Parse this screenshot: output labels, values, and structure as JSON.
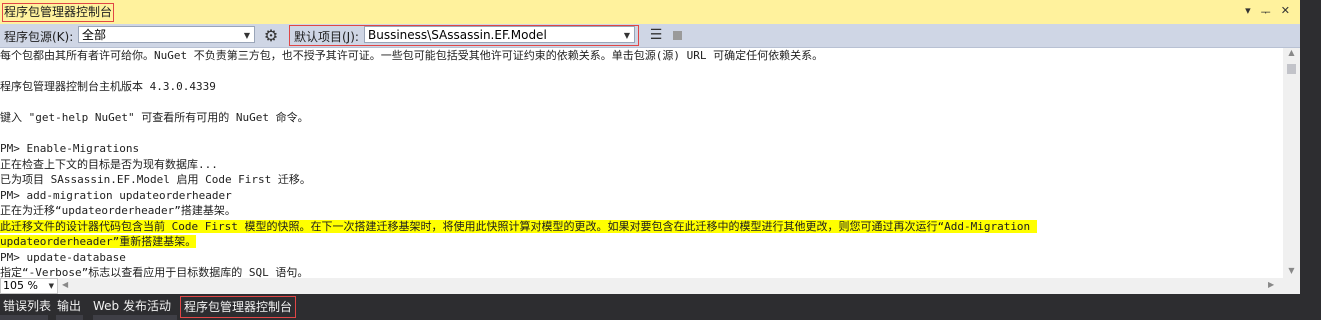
{
  "title": "程序包管理器控制台",
  "toolbar": {
    "source_label": "程序包源(K):",
    "source_value": "全部",
    "project_label": "默认项目(J):",
    "project_value": "Bussiness\\SAssassin.EF.Model"
  },
  "icons": {
    "settings": "gear-icon",
    "clear": "clear-console-icon",
    "stop": "stop-icon",
    "dropdown": "chevron-down-icon"
  },
  "console_lines": [
    {
      "text": "每个包都由其所有者许可给你。NuGet 不负责第三方包，也不授予其许可证。一些包可能包括受其他许可证约束的依赖关系。单击包源(源) URL 可确定任何依赖关系。",
      "highlight": false
    },
    {
      "text": "",
      "highlight": false
    },
    {
      "text": "程序包管理器控制台主机版本 4.3.0.4339",
      "highlight": false
    },
    {
      "text": "",
      "highlight": false
    },
    {
      "text": "键入 \"get-help NuGet\" 可查看所有可用的 NuGet 命令。",
      "highlight": false
    },
    {
      "text": "",
      "highlight": false
    },
    {
      "text": "PM> Enable-Migrations",
      "highlight": false
    },
    {
      "text": "正在检查上下文的目标是否为现有数据库...",
      "highlight": false
    },
    {
      "text": "已为项目 SAssassin.EF.Model 启用 Code First 迁移。",
      "highlight": false
    },
    {
      "text": "PM> add-migration updateorderheader",
      "highlight": false
    },
    {
      "text": "正在为迁移“updateorderheader”搭建基架。",
      "highlight": false
    },
    {
      "text": "此迁移文件的设计器代码包含当前 Code First 模型的快照。在下一次搭建迁移基架时，将使用此快照计算对模型的更改。如果对要包含在此迁移中的模型进行其他更改，则您可通过再次运行“Add-Migration ",
      "highlight": true
    },
    {
      "text": "updateorderheader”重新搭建基架。",
      "highlight": true
    },
    {
      "text": "PM> update-database",
      "highlight": false
    },
    {
      "text": "指定“-Verbose”标志以查看应用于目标数据库的 SQL 语句。",
      "highlight": false
    }
  ],
  "zoom": "105 %",
  "colors": {
    "title_bg": "#fff29d",
    "toolbar_bg": "#cfd6e5",
    "highlight": "#ffff00",
    "annotation_border": "#e04646",
    "tab_bar_bg": "#2d2d30"
  },
  "tabs": [
    {
      "label": "错误列表",
      "active": false
    },
    {
      "label": "输出",
      "active": false
    },
    {
      "label": "Web 发布活动",
      "active": false
    },
    {
      "label": "程序包管理器控制台",
      "active": true
    }
  ]
}
